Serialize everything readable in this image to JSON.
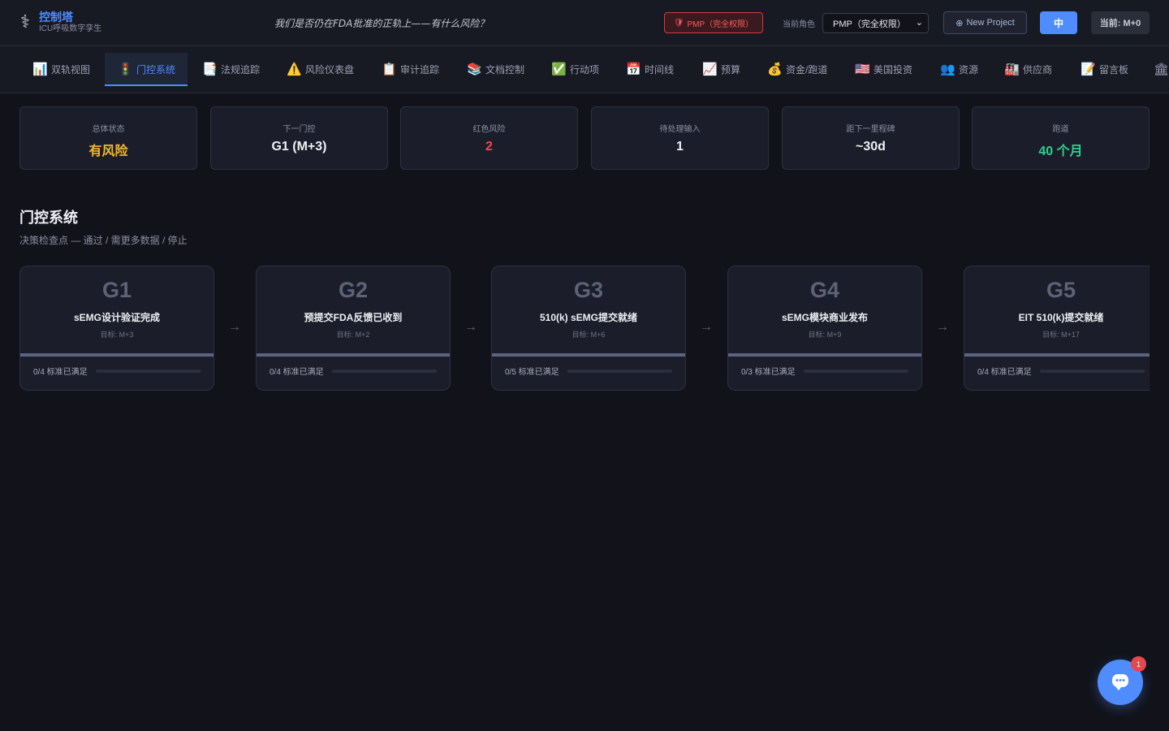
{
  "header": {
    "brand_icon": "⚕",
    "title": "控制塔",
    "subtitle": "ICU呼吸数字孪生",
    "tagline": "我们是否仍在FDA批准的正轨上——有什么风险？",
    "permission_badge": "PMP（完全权限）",
    "role_label": "当前角色",
    "role_value": "PMP（完全权限）",
    "new_project_label": "New Project",
    "lang_button": "中",
    "current_label": "当前: M+0"
  },
  "nav": {
    "tabs": [
      {
        "icon": "📊",
        "label": "双轨视图",
        "active": false
      },
      {
        "icon": "🚦",
        "label": "门控系统",
        "active": true
      },
      {
        "icon": "📑",
        "label": "法规追踪",
        "active": false
      },
      {
        "icon": "⚠️",
        "label": "风险仪表盘",
        "active": false
      },
      {
        "icon": "📋",
        "label": "审计追踪",
        "active": false
      },
      {
        "icon": "📚",
        "label": "文档控制",
        "active": false
      },
      {
        "icon": "✅",
        "label": "行动项",
        "active": false
      },
      {
        "icon": "📅",
        "label": "时间线",
        "active": false
      },
      {
        "icon": "📈",
        "label": "预算",
        "active": false
      },
      {
        "icon": "💰",
        "label": "资金/跑道",
        "active": false
      },
      {
        "icon": "🇺🇸",
        "label": "美国投资",
        "active": false
      },
      {
        "icon": "👥",
        "label": "资源",
        "active": false
      },
      {
        "icon": "🏭",
        "label": "供应商",
        "active": false
      },
      {
        "icon": "📝",
        "label": "留言板",
        "active": false
      },
      {
        "icon": "🏛",
        "label": "",
        "active": false
      }
    ]
  },
  "stats": [
    {
      "label": "总体状态",
      "value": "有风险",
      "color": "#f5b829"
    },
    {
      "label": "下一门控",
      "value": "G1 (M+3)",
      "color": "#eef0f5"
    },
    {
      "label": "红色风险",
      "value": "2",
      "color": "#ef4b4b"
    },
    {
      "label": "待处理输入",
      "value": "1",
      "color": "#eef0f5"
    },
    {
      "label": "距下一里程碑",
      "value": "~30d",
      "color": "#eef0f5"
    },
    {
      "label": "跑道",
      "value": "40 个月",
      "color": "#2fd08f"
    }
  ],
  "section": {
    "title": "门控系统",
    "subtitle": "决策检查点 — 通过 / 需更多数据 / 停止"
  },
  "gates": [
    {
      "id": "G1",
      "name": "sEMG设计验证完成",
      "target": "目标: M+3",
      "met": 0,
      "total": 4,
      "criteria": "0/4 标准已满足"
    },
    {
      "id": "G2",
      "name": "预提交FDA反馈已收到",
      "target": "目标: M+2",
      "met": 0,
      "total": 4,
      "criteria": "0/4 标准已满足"
    },
    {
      "id": "G3",
      "name": "510(k) sEMG提交就绪",
      "target": "目标: M+6",
      "met": 0,
      "total": 5,
      "criteria": "0/5 标准已满足"
    },
    {
      "id": "G4",
      "name": "sEMG模块商业发布",
      "target": "目标: M+9",
      "met": 0,
      "total": 3,
      "criteria": "0/3 标准已满足"
    },
    {
      "id": "G5",
      "name": "EIT 510(k)提交就绪",
      "target": "目标: M+17",
      "met": 0,
      "total": 4,
      "criteria": "0/4 标准已满足"
    }
  ],
  "arrow_glyph": "→",
  "chat": {
    "badge_count": "1"
  }
}
